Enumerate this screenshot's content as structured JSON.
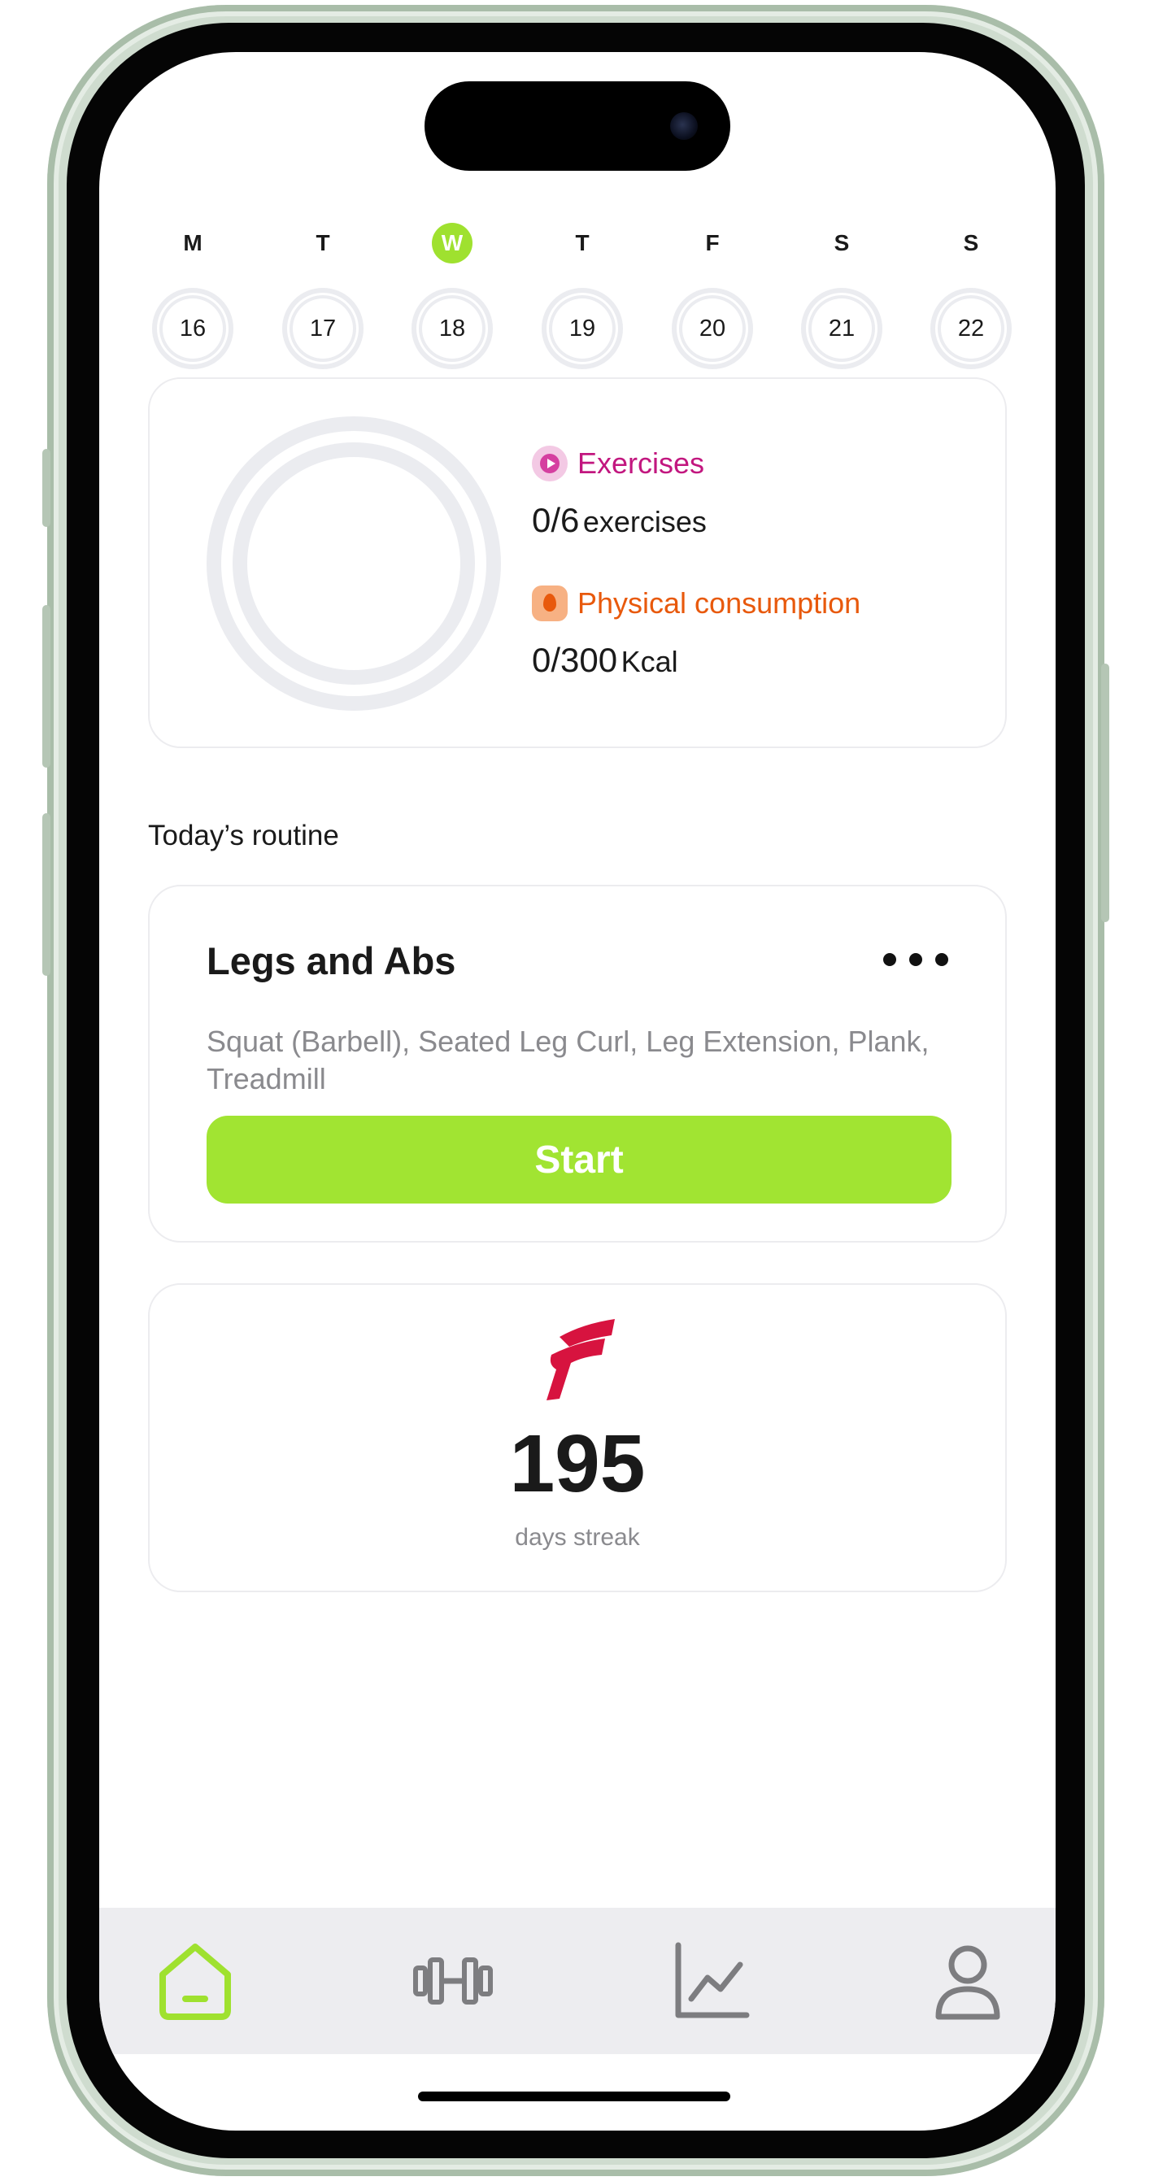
{
  "week": {
    "days": [
      {
        "letter": "M",
        "date": "16",
        "active": false
      },
      {
        "letter": "T",
        "date": "17",
        "active": false
      },
      {
        "letter": "W",
        "date": "18",
        "active": true
      },
      {
        "letter": "T",
        "date": "19",
        "active": false
      },
      {
        "letter": "F",
        "date": "20",
        "active": false
      },
      {
        "letter": "S",
        "date": "21",
        "active": false
      },
      {
        "letter": "S",
        "date": "22",
        "active": false
      }
    ]
  },
  "progress": {
    "exercises": {
      "label": "Exercises",
      "value": "0/6",
      "unit": "exercises",
      "color": "#c2177f",
      "icon": "play-clock-icon"
    },
    "consumption": {
      "label": "Physical consumption",
      "value": "0/300",
      "unit": "Kcal",
      "color": "#e8590c",
      "icon": "fire-icon"
    }
  },
  "routine": {
    "section_title": "Today’s routine",
    "title": "Legs and Abs",
    "description": "Squat (Barbell), Seated Leg Curl, Leg Extension, Plank, Treadmill",
    "start_label": "Start"
  },
  "streak": {
    "value": "195",
    "label": "days streak",
    "icon": "streak-logo-icon",
    "color": "#d7133f"
  },
  "tabbar": {
    "items": [
      {
        "icon": "home-icon",
        "active": true
      },
      {
        "icon": "dumbbell-icon",
        "active": false
      },
      {
        "icon": "chart-icon",
        "active": false
      },
      {
        "icon": "profile-icon",
        "active": false
      }
    ]
  },
  "colors": {
    "accent": "#9fe12f",
    "inactive_tab": "#7d7d80"
  }
}
